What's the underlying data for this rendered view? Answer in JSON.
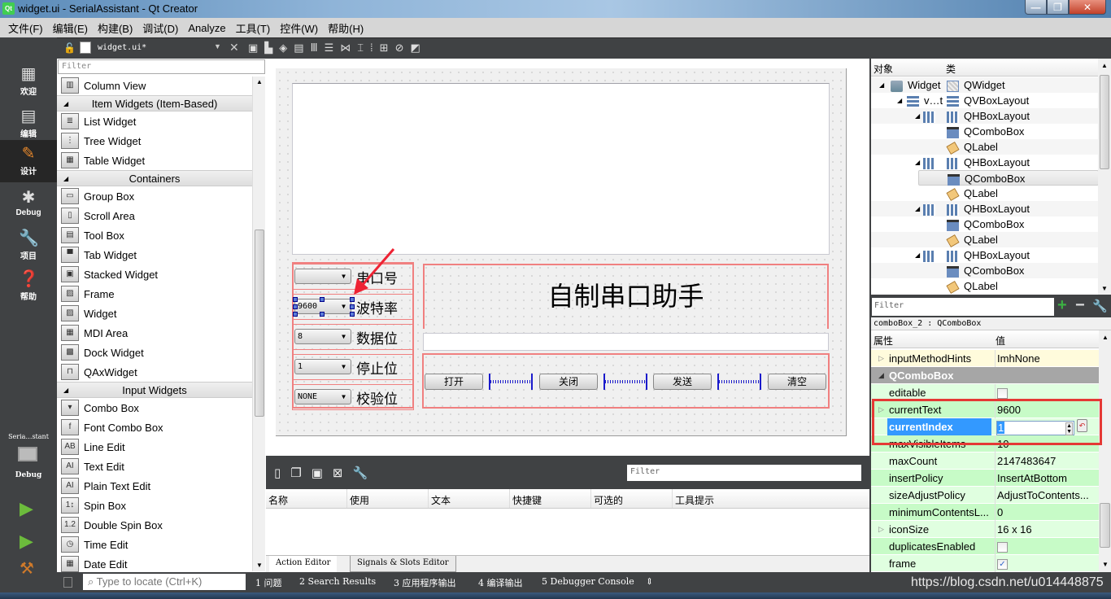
{
  "window": {
    "title": "widget.ui - SerialAssistant - Qt Creator",
    "app_icon": "Qt"
  },
  "menu": [
    "文件(F)",
    "编辑(E)",
    "构建(B)",
    "调试(D)",
    "Analyze",
    "工具(T)",
    "控件(W)",
    "帮助(H)"
  ],
  "doc_toolbar": {
    "file_name": "widget.ui*"
  },
  "modes": [
    {
      "label": "欢迎",
      "icon": "grid-icon"
    },
    {
      "label": "编辑",
      "icon": "edit-doc-icon"
    },
    {
      "label": "设计",
      "icon": "pencil-icon",
      "active": true
    },
    {
      "label": "Debug",
      "icon": "bug-icon"
    },
    {
      "label": "项目",
      "icon": "wrench-icon"
    },
    {
      "label": "帮助",
      "icon": "help-icon"
    }
  ],
  "kit": {
    "project": "Seria…stant",
    "mode": "Debug"
  },
  "widget_box": {
    "filter_placeholder": "Filter",
    "rows": [
      {
        "type": "item",
        "label": "Column View",
        "glyph": "▥"
      },
      {
        "type": "cat",
        "label": "Item Widgets (Item-Based)"
      },
      {
        "type": "item",
        "label": "List Widget",
        "glyph": "≣"
      },
      {
        "type": "item",
        "label": "Tree Widget",
        "glyph": "⋮"
      },
      {
        "type": "item",
        "label": "Table Widget",
        "glyph": "▦"
      },
      {
        "type": "cat",
        "label": "Containers"
      },
      {
        "type": "item",
        "label": "Group Box",
        "glyph": "▭"
      },
      {
        "type": "item",
        "label": "Scroll Area",
        "glyph": "▯"
      },
      {
        "type": "item",
        "label": "Tool Box",
        "glyph": "▤"
      },
      {
        "type": "item",
        "label": "Tab Widget",
        "glyph": "▀"
      },
      {
        "type": "item",
        "label": "Stacked Widget",
        "glyph": "▣"
      },
      {
        "type": "item",
        "label": "Frame",
        "glyph": "▨"
      },
      {
        "type": "item",
        "label": "Widget",
        "glyph": "▨"
      },
      {
        "type": "item",
        "label": "MDI Area",
        "glyph": "▦"
      },
      {
        "type": "item",
        "label": "Dock Widget",
        "glyph": "▩"
      },
      {
        "type": "item",
        "label": "QAxWidget",
        "glyph": "⊓"
      },
      {
        "type": "cat",
        "label": "Input Widgets"
      },
      {
        "type": "item",
        "label": "Combo Box",
        "glyph": "▾"
      },
      {
        "type": "item",
        "label": "Font Combo Box",
        "glyph": "f"
      },
      {
        "type": "item",
        "label": "Line Edit",
        "glyph": "AB"
      },
      {
        "type": "item",
        "label": "Text Edit",
        "glyph": "AI"
      },
      {
        "type": "item",
        "label": "Plain Text Edit",
        "glyph": "AI"
      },
      {
        "type": "item",
        "label": "Spin Box",
        "glyph": "1↕"
      },
      {
        "type": "item",
        "label": "Double Spin Box",
        "glyph": "1.2"
      },
      {
        "type": "item",
        "label": "Time Edit",
        "glyph": "◷"
      },
      {
        "type": "item",
        "label": "Date Edit",
        "glyph": "▦"
      }
    ]
  },
  "form": {
    "rows": [
      {
        "combo": "",
        "label": "串口号"
      },
      {
        "combo": "9600",
        "label": "波特率",
        "selected": true
      },
      {
        "combo": "8",
        "label": "数据位"
      },
      {
        "combo": "1",
        "label": "停止位"
      },
      {
        "combo": "NONE",
        "label": "校验位"
      }
    ],
    "title_label": "自制串口助手",
    "buttons": [
      "打开",
      "关闭",
      "发送",
      "清空"
    ]
  },
  "action_editor": {
    "filter_placeholder": "Filter",
    "columns": [
      "名称",
      "使用",
      "文本",
      "快捷键",
      "可选的",
      "工具提示"
    ],
    "tabs": [
      "Action Editor",
      "Signals & Slots Editor"
    ]
  },
  "object_inspector": {
    "columns": [
      "对象",
      "类"
    ],
    "rows": [
      {
        "depth": 0,
        "obj": "Widget",
        "cls": "QWidget",
        "exp": true,
        "icon": "widget"
      },
      {
        "depth": 1,
        "obj": "v…t",
        "cls": "QVBoxLayout",
        "exp": true,
        "icon": "vbox"
      },
      {
        "depth": 2,
        "obj": "",
        "cls": "QHBoxLayout",
        "exp": true,
        "icon": "hbox"
      },
      {
        "depth": 3,
        "obj": "",
        "cls": "QComboBox",
        "icon": "combo"
      },
      {
        "depth": 3,
        "obj": "",
        "cls": "QLabel",
        "icon": "label"
      },
      {
        "depth": 2,
        "obj": "",
        "cls": "QHBoxLayout",
        "exp": true,
        "icon": "hbox"
      },
      {
        "depth": 3,
        "obj": "",
        "cls": "QComboBox",
        "icon": "combo",
        "selected": true
      },
      {
        "depth": 3,
        "obj": "",
        "cls": "QLabel",
        "icon": "label"
      },
      {
        "depth": 2,
        "obj": "",
        "cls": "QHBoxLayout",
        "exp": true,
        "icon": "hbox"
      },
      {
        "depth": 3,
        "obj": "",
        "cls": "QComboBox",
        "icon": "combo"
      },
      {
        "depth": 3,
        "obj": "",
        "cls": "QLabel",
        "icon": "label"
      },
      {
        "depth": 2,
        "obj": "",
        "cls": "QHBoxLayout",
        "exp": true,
        "icon": "hbox"
      },
      {
        "depth": 3,
        "obj": "",
        "cls": "QComboBox",
        "icon": "combo"
      },
      {
        "depth": 3,
        "obj": "",
        "cls": "QLabel",
        "icon": "label"
      }
    ]
  },
  "property_editor": {
    "filter_placeholder": "Filter",
    "object_label": "comboBox_2 : QComboBox",
    "columns": [
      "属性",
      "值"
    ],
    "rows": [
      {
        "name": "inputMethodHints",
        "value": "ImhNone",
        "exp": true,
        "bg": "#fffbdc"
      },
      {
        "name": "QComboBox",
        "section": true
      },
      {
        "name": "editable",
        "check": false,
        "bg": "#e0ffe0"
      },
      {
        "name": "currentText",
        "value": "9600",
        "exp": true,
        "bg": "#c7fbc7"
      },
      {
        "name": "currentIndex",
        "value": "1",
        "editing": true,
        "bg": "#e0ffe0"
      },
      {
        "name": "maxVisibleItems",
        "value": "10",
        "bg": "#c7fbc7"
      },
      {
        "name": "maxCount",
        "value": "2147483647",
        "bg": "#e0ffe0"
      },
      {
        "name": "insertPolicy",
        "value": "InsertAtBottom",
        "bg": "#c7fbc7"
      },
      {
        "name": "sizeAdjustPolicy",
        "value": "AdjustToContents...",
        "bg": "#e0ffe0"
      },
      {
        "name": "minimumContentsL...",
        "value": "0",
        "bg": "#c7fbc7"
      },
      {
        "name": "iconSize",
        "value": "16 x 16",
        "exp": true,
        "bg": "#e0ffe0"
      },
      {
        "name": "duplicatesEnabled",
        "check": false,
        "bg": "#c7fbc7"
      },
      {
        "name": "frame",
        "check": true,
        "bg": "#e0ffe0"
      }
    ]
  },
  "status": {
    "locator_placeholder": "Type to locate (Ctrl+K)",
    "panes": [
      "1 问题",
      "2 Search Results",
      "3 应用程序输出",
      "4 编译输出",
      "5 Debugger Console"
    ]
  },
  "watermark": "https://blog.csdn.net/u014448875"
}
